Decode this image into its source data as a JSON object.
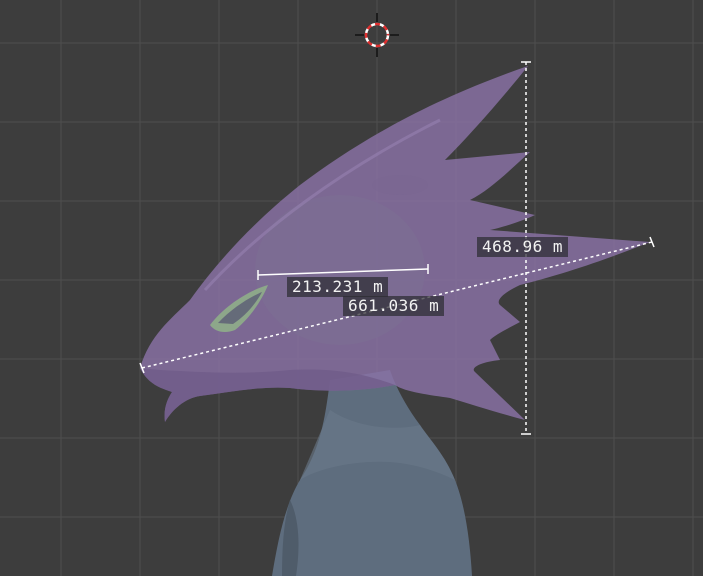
{
  "viewport": {
    "background_color": "#3d3d3d",
    "grid_color": "#4f4f4f",
    "cursor_icon": "3d-cursor-icon"
  },
  "model": {
    "head_color": "#8a72a6",
    "body_color": "#5e6d7e"
  },
  "measurements": [
    {
      "id": "vertical-height",
      "label": "468.96 m"
    },
    {
      "id": "skull-width",
      "label": "213.231 m"
    },
    {
      "id": "head-length",
      "label": "661.036 m"
    }
  ]
}
